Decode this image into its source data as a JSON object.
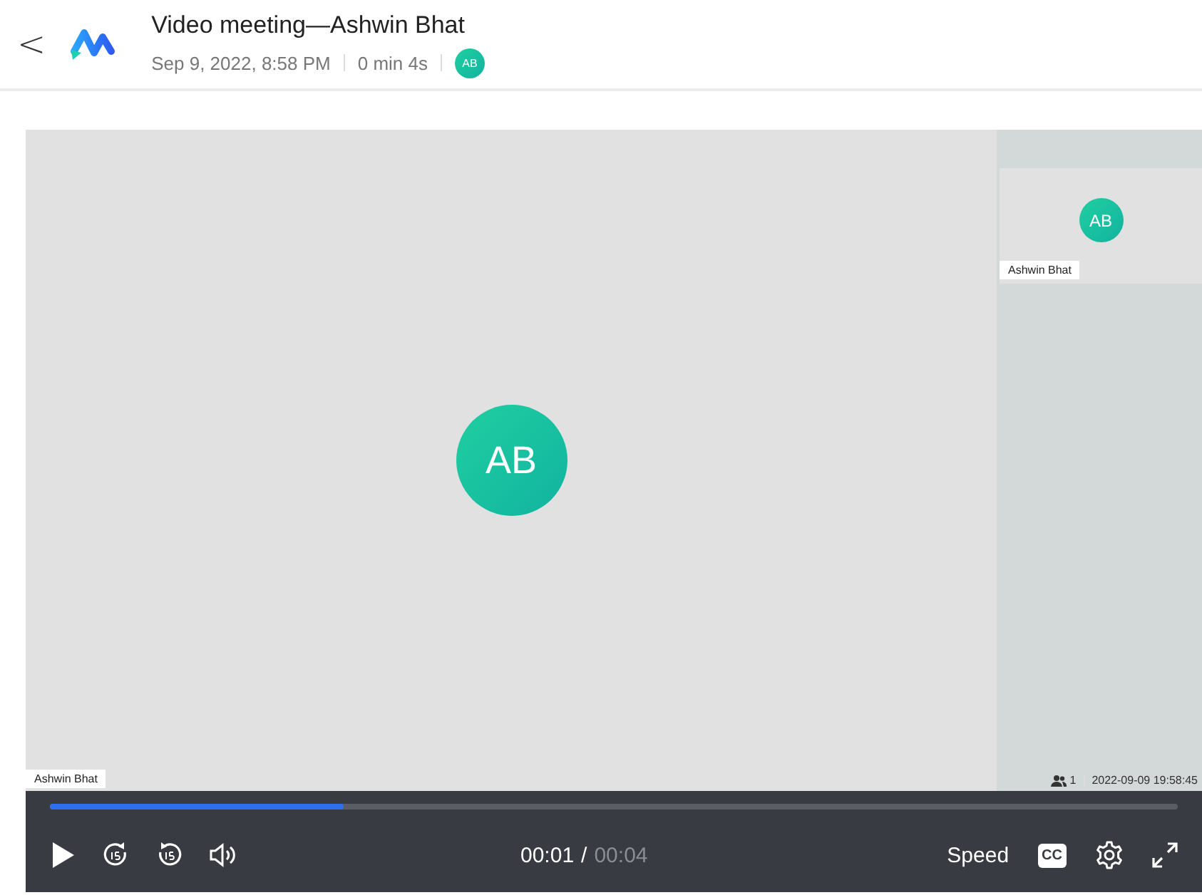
{
  "header": {
    "back": "<",
    "title": "Video meeting—Ashwin Bhat",
    "date": "Sep 9, 2022, 8:58 PM",
    "duration": "0 min 4s",
    "participant_avatar": "AB"
  },
  "recording": {
    "main_tile": {
      "avatar": "AB",
      "name": "Ashwin Bhat"
    },
    "side_tile": {
      "avatar": "AB",
      "name": "Ashwin Bhat"
    },
    "participant_count": "1",
    "timestamp": "2022-09-09 19:58:45"
  },
  "player": {
    "progress": {
      "level": 0.26
    },
    "current_time": "00:01",
    "separator": "/",
    "total_time": "00:04",
    "speed": "Speed",
    "captions": "CC"
  }
}
